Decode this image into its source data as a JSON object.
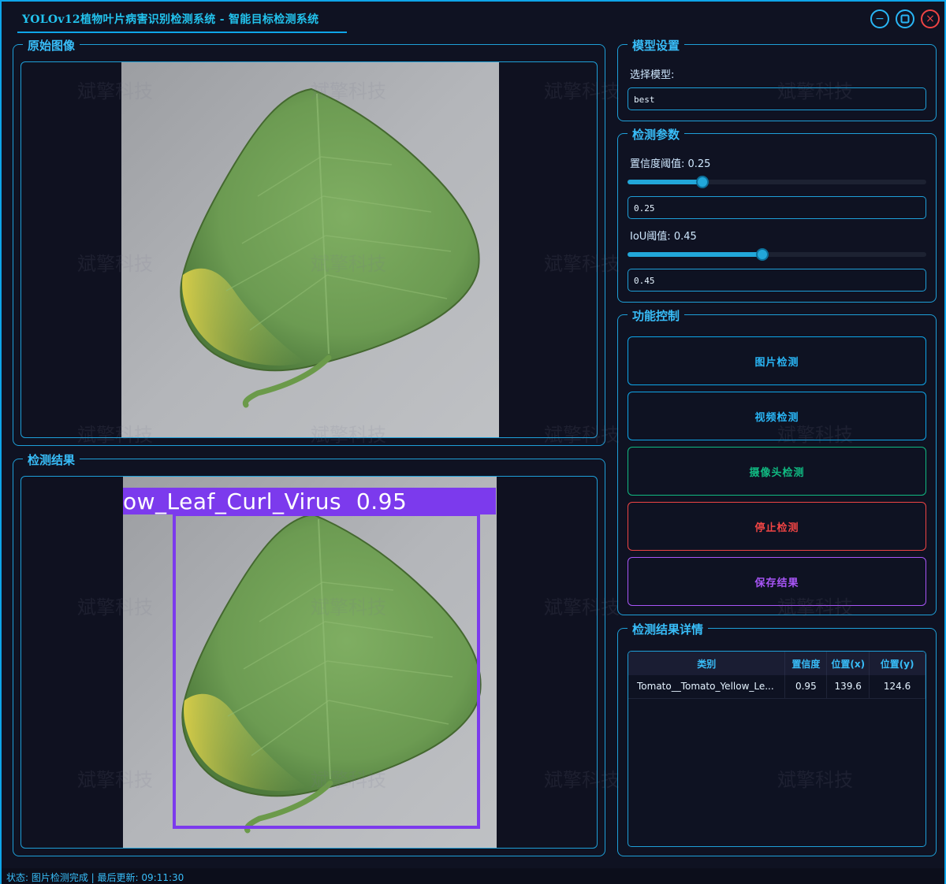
{
  "window": {
    "title": "YOLOv12植物叶片病害识别检测系统 - 智能目标检测系统",
    "minimize_glyph": "−",
    "maximize_glyph": "□",
    "close_glyph": "×"
  },
  "panels": {
    "original_title": "原始图像",
    "result_title": "检测结果"
  },
  "detection_overlay": {
    "label": "ow_Leaf_Curl_Virus  0.95",
    "box_color": "#7c3aed"
  },
  "model_settings": {
    "title": "模型设置",
    "select_label": "选择模型:",
    "model_value": "best"
  },
  "params": {
    "title": "检测参数",
    "confidence_label": "置信度阈值: 0.25",
    "confidence_value": "0.25",
    "confidence_fraction": 0.25,
    "iou_label": "IoU阈值: 0.45",
    "iou_value": "0.45",
    "iou_fraction": 0.45
  },
  "controls": {
    "title": "功能控制",
    "image_detect": "图片检测",
    "video_detect": "视频检测",
    "camera_detect": "摄像头检测",
    "stop_detect": "停止检测",
    "save_result": "保存结果"
  },
  "results": {
    "title": "检测结果详情",
    "columns": [
      "类别",
      "置信度",
      "位置(x)",
      "位置(y)"
    ],
    "rows": [
      [
        "Tomato__Tomato_Yellow_Le...",
        "0.95",
        "139.6",
        "124.6"
      ]
    ]
  },
  "status": {
    "text": "状态: 图片检测完成 | 最后更新: 09:11:30"
  },
  "watermark": "斌擎科技",
  "colors": {
    "accent": "#0ea5e9",
    "camera_button": "#10b981",
    "stop_button": "#ef4444",
    "save_button": "#a855f7"
  },
  "icons": [
    "minimize-icon",
    "maximize-icon",
    "close-icon"
  ]
}
